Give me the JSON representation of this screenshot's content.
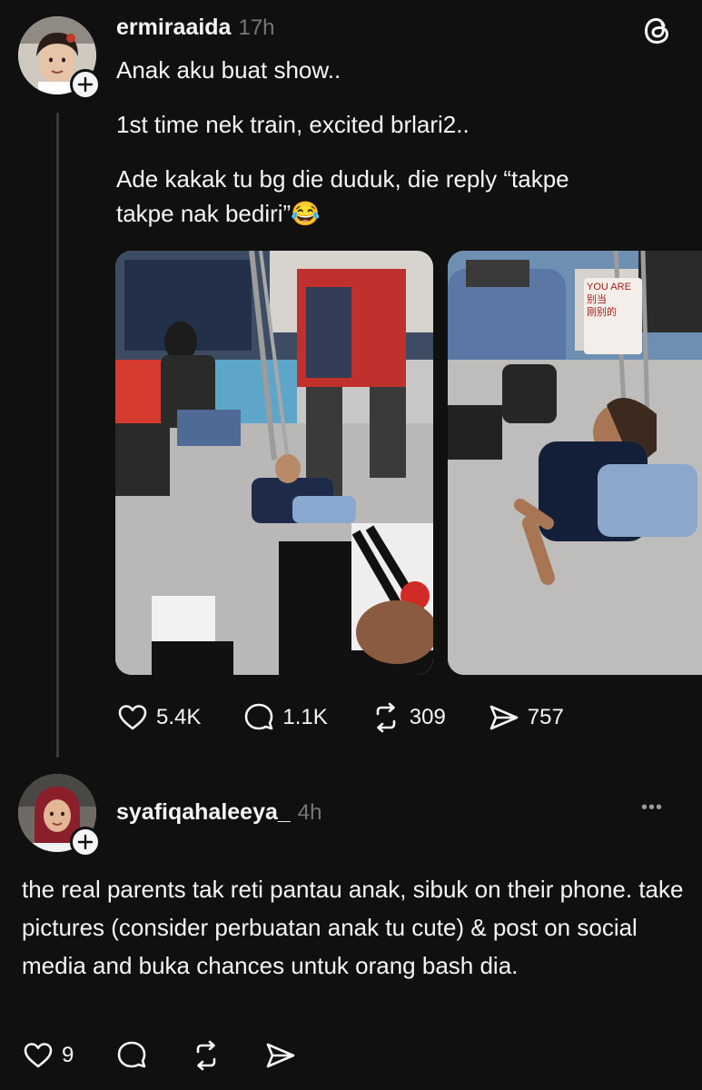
{
  "post1": {
    "username": "ermiraaida",
    "time": "17h",
    "text_lines": [
      "Anak aku buat show..",
      "1st time nek train, excited brlari2..",
      "Ade kakak tu bg die duduk, die reply “takpe",
      "takpe nak bediri”😂"
    ],
    "likes": "5.4K",
    "replies": "1.1K",
    "reposts": "309",
    "shares": "757"
  },
  "post2": {
    "username": "syafiqahaleeya_",
    "time": "4h",
    "more_label": "•••",
    "text": "the real parents tak reti pantau anak, sibuk on their phone. take pictures (consider perbuatan anak tu cute) & post on social media and buka chances untuk orang bash dia.",
    "likes": "9"
  },
  "photo_sign_text": "YOU ARE\n别当\n刚别的",
  "colors": {
    "background": "#101010",
    "text": "#f3f5f7",
    "muted": "#777777",
    "thread_line": "#3a3a3a"
  },
  "icons": [
    "threads-logo-icon",
    "plus-icon",
    "heart-icon",
    "comment-icon",
    "repost-icon",
    "share-icon",
    "more-icon"
  ]
}
